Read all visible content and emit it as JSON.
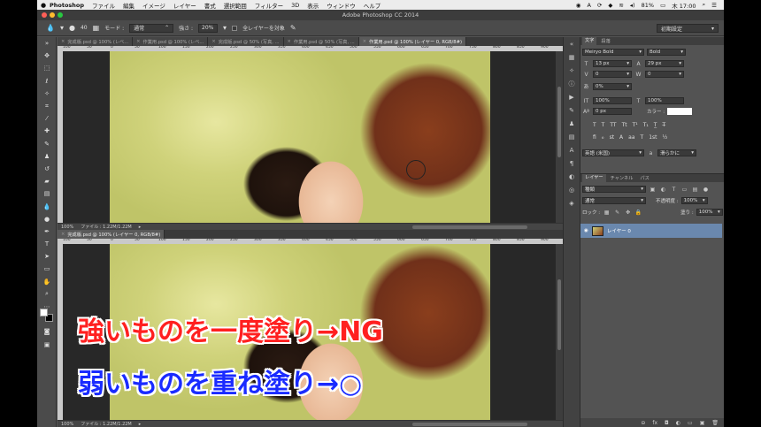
{
  "menubar": {
    "app": "Photoshop",
    "items": [
      "ファイル",
      "編集",
      "イメージ",
      "レイヤー",
      "書式",
      "選択範囲",
      "フィルター",
      "3D",
      "表示",
      "ウィンドウ",
      "ヘルプ"
    ],
    "battery": "81%",
    "clock": "木 17:00"
  },
  "window": {
    "title": "Adobe Photoshop CC 2014"
  },
  "options": {
    "mode_label": "モード :",
    "mode_value": "通常",
    "strength_label": "強さ :",
    "strength_value": "20%",
    "all_layers_label": "全レイヤーを対象",
    "brush_size": "40",
    "preset": "初期設定"
  },
  "doc1": {
    "tabs": [
      "完成版.psd @ 100% (レベ...",
      "作業用.psd @ 100% (レベ...",
      "完成版.psd @ 50% (写真, ...",
      "作業用.psd @ 50% (写真, ...",
      "作業用.psd @ 100% (レイヤー 0, RGB/8#)"
    ],
    "active_tab": 4,
    "ruler": [
      "100",
      "50",
      "0",
      "50",
      "100",
      "150",
      "200",
      "250",
      "300",
      "350",
      "400",
      "450",
      "500",
      "550",
      "600",
      "650",
      "700",
      "750",
      "800",
      "850",
      "900"
    ],
    "zoom": "100%",
    "file_info": "ファイル : 1.22M/1.22M"
  },
  "doc2": {
    "title": "完成版.psd @ 100% (レイヤー 0, RGB/8#)",
    "ruler": [
      "100",
      "50",
      "0",
      "50",
      "100",
      "150",
      "200",
      "250",
      "300",
      "350",
      "400",
      "450",
      "500",
      "550",
      "600",
      "650",
      "700",
      "750",
      "800",
      "850",
      "900"
    ],
    "zoom": "100%",
    "file_info": "ファイル : 1.22M/1.22M"
  },
  "character": {
    "tabs": [
      "文字",
      "段落"
    ],
    "font_family": "Meiryo Bold",
    "font_style": "Bold",
    "size": "13 px",
    "leading": "29 px",
    "kerning": "0",
    "tracking": "0",
    "tsume": "0%",
    "vscale": "100%",
    "hscale": "100%",
    "baseline": "0 px",
    "color_label": "カラー :",
    "language": "英語 (米国)",
    "aa": "滑らかに",
    "aa_prefix": "a"
  },
  "layers": {
    "tabs": [
      "レイヤー",
      "チャンネル",
      "パス"
    ],
    "filter": "種類",
    "blend": "通常",
    "opacity_label": "不透明度 :",
    "opacity": "100%",
    "lock_label": "ロック :",
    "fill_label": "塗り :",
    "fill": "100%",
    "layer_name": "レイヤー 0"
  },
  "captions": {
    "line1": "強いものを一度塗り→NG",
    "line2": "弱いものを重ね塗り→○"
  }
}
